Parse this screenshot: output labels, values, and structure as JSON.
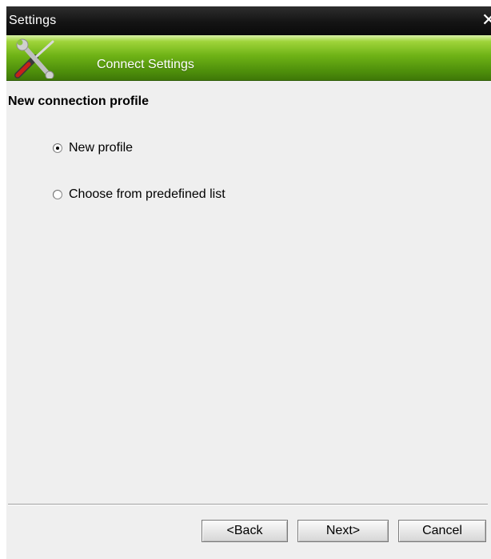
{
  "window": {
    "title": "Settings",
    "close_glyph": "✕"
  },
  "banner": {
    "title": "Connect Settings",
    "icon": "tools-icon"
  },
  "content": {
    "heading": "New connection profile",
    "options": [
      {
        "label": "New profile",
        "selected": true
      },
      {
        "label": "Choose from predefined list",
        "selected": false
      }
    ]
  },
  "buttons": {
    "back_label": "<Back",
    "next_label": "Next>",
    "cancel_label": "Cancel"
  },
  "colors": {
    "titlebar": "#141414",
    "banner_green": "#6fb316",
    "background": "#efefef"
  }
}
